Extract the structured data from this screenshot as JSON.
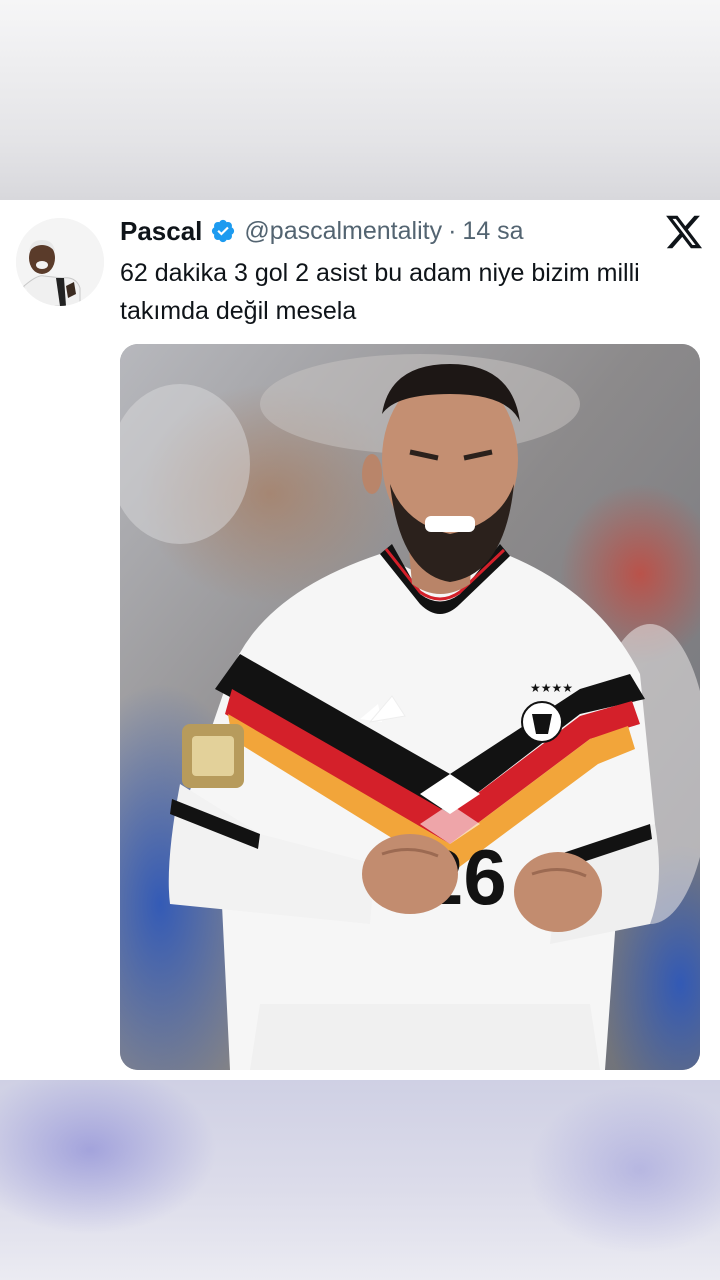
{
  "post": {
    "author_name": "Pascal",
    "handle": "@pascalmentality",
    "time_separator": "·",
    "timestamp": "14 sa",
    "text": "62 dakika 3 gol 2 asist bu adam niye bizim milli takımda değil mesela",
    "verified": true,
    "platform_icon": "x-logo-icon",
    "jersey_number": "26"
  },
  "colors": {
    "verified_blue": "#1d9bf0",
    "text_primary": "#0f1419",
    "text_secondary": "#536471",
    "kit_red": "#d4202a",
    "kit_gold": "#f2a53a",
    "kit_black": "#121212"
  }
}
